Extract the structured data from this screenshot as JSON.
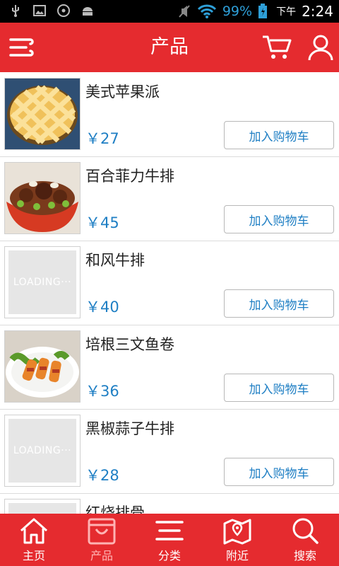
{
  "status_bar": {
    "battery_percent": "99%",
    "ampm": "下午",
    "time": "2:24",
    "icons": [
      "usb-icon",
      "image-icon",
      "media-icon",
      "android-icon",
      "mute-icon",
      "wifi-icon",
      "battery-icon"
    ]
  },
  "header": {
    "title": "产品",
    "icons": [
      "menu-icon",
      "cart-icon",
      "user-icon"
    ],
    "bg_color": "#e52b2f"
  },
  "products": [
    {
      "name": "美式苹果派",
      "price": "￥27",
      "button": "加入购物车",
      "image": "apple-pie"
    },
    {
      "name": "百合菲力牛排",
      "price": "￥45",
      "button": "加入购物车",
      "image": "steak-pepper"
    },
    {
      "name": "和风牛排",
      "price": "￥40",
      "button": "加入购物车",
      "image": "loading"
    },
    {
      "name": "培根三文鱼卷",
      "price": "￥36",
      "button": "加入购物车",
      "image": "salmon-rolls"
    },
    {
      "name": "黑椒蒜子牛排",
      "price": "￥28",
      "button": "加入购物车",
      "image": "loading"
    },
    {
      "name": "红烧排骨",
      "price": "",
      "button": "",
      "image": "loading"
    }
  ],
  "loading_text": "LOADING···",
  "bottom_nav": [
    {
      "label": "主页",
      "icon": "home-icon",
      "active": false
    },
    {
      "label": "产品",
      "icon": "shopping-bag-icon",
      "active": true
    },
    {
      "label": "分类",
      "icon": "list-icon",
      "active": false
    },
    {
      "label": "附近",
      "icon": "map-icon",
      "active": false
    },
    {
      "label": "搜索",
      "icon": "search-icon",
      "active": false
    }
  ],
  "colors": {
    "accent": "#e52b2f",
    "price": "#1f7fc4"
  }
}
